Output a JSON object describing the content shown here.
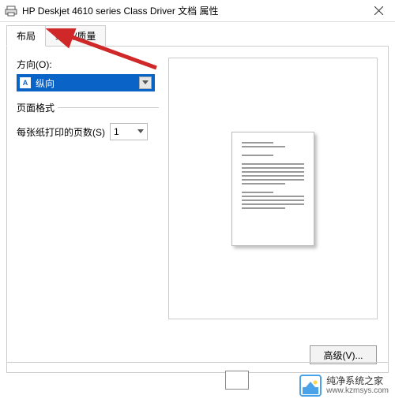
{
  "window": {
    "title": "HP Deskjet 4610 series Class Driver 文档 属性",
    "close": "×"
  },
  "tabs": {
    "layout": "布局",
    "paper_quality": "纸张/质量"
  },
  "orientation": {
    "label": "方向(O):",
    "value": "纵向",
    "icon_letter": "A"
  },
  "page_format": {
    "legend": "页面格式",
    "pages_per_sheet_label": "每张纸打印的页数(S)",
    "pages_value": "1"
  },
  "advanced_button": "高级(V)...",
  "watermark": {
    "name": "纯净系统之家",
    "url": "www.kzmsys.com"
  }
}
